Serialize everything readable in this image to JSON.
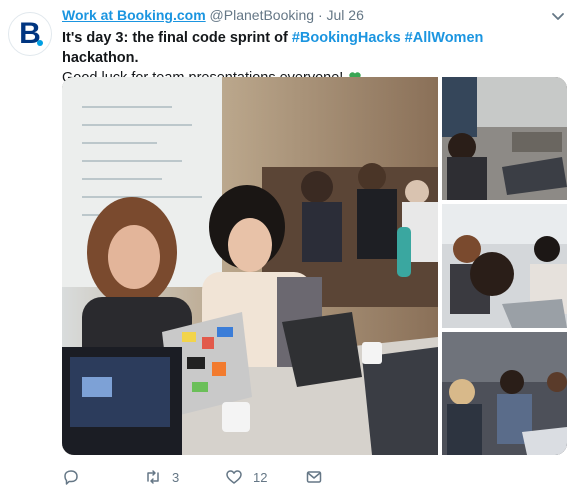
{
  "tweet": {
    "display_name": "Work at Booking.com",
    "handle": "@PlanetBooking",
    "separator": "·",
    "date": "Jul 26",
    "text_part1": "It's day 3: the final code sprint of ",
    "hashtag1": "#BookingHacks",
    "hashtag2": "#AllWomen",
    "text_part2": " hackathon.",
    "text_line2": "Good luck for team presentations everyone!",
    "avatar_letter": "B",
    "retweet_count": "3",
    "like_count": "12"
  },
  "colors": {
    "link": "#1b95e0",
    "brand_blue": "#003580",
    "brand_dot": "#009fe3",
    "muted": "#657786"
  },
  "icons": [
    "chevron-down-icon",
    "clover-icon",
    "reply-icon",
    "retweet-icon",
    "like-icon",
    "dm-icon"
  ]
}
